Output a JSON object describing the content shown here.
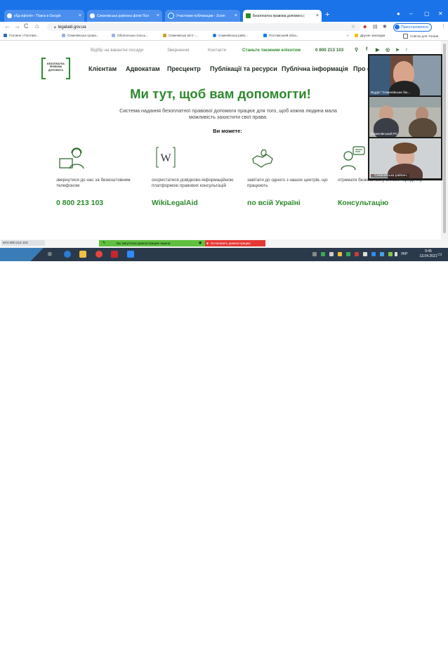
{
  "browser": {
    "tabs": [
      {
        "title": "убд ефіопія - Поиск в Google",
        "favicon_color": "#ffffff",
        "active": false
      },
      {
        "title": "Семенівська районна філія Пол",
        "favicon_color": "#ffffff",
        "active": false
      },
      {
        "title": "Участники публикации - Zoom",
        "favicon_color": "#2d8cff",
        "active": false
      },
      {
        "title": "Безоплатна правова допомога |",
        "favicon_color": "#2f8a2f",
        "active": true
      }
    ],
    "url": "legalaid.gov.ua",
    "profile_status": "Приостановлена",
    "bookmarks": [
      "Головне | Полтавс...",
      "Семенівська грома...",
      "Оболонська сільсь...",
      "Семенівські вісті -...",
      "Семенівська райо...",
      "Полтавський обла...",
      "Другие закладки",
      "Список для чтения"
    ]
  },
  "site": {
    "top_links": [
      "Відбір на вакантні посади",
      "Звернення",
      "Контакти"
    ],
    "cta": "Станьте таємним клієнтом",
    "phone_top": "0 800 213 103",
    "logo_lines": [
      "БЕЗОПЛАТНА",
      "ПРАВОВА",
      "ДОПОМОГА"
    ],
    "main_nav": [
      "Клієнтам",
      "Адвокатам",
      "Пресцентр",
      "Публікації та ресурси",
      "Публічна інформація",
      "Про с"
    ],
    "hero_title": "Ми тут, щоб вам допомогти!",
    "hero_subtitle": "Система надання безоплатної правової допомоги працює для того, щоб кожна людина мала можливість захистити свої права.",
    "you_can": "Ви можете:",
    "features": [
      {
        "icon": "headset-icon",
        "desc": "звернутися до нас за безкоштовним телефоном",
        "big": "0 800 213 103"
      },
      {
        "icon": "wikipedia-icon",
        "desc": "скористатися довідково-інформаційною платформою правових консультацій",
        "big": "WikiLegalAid"
      },
      {
        "icon": "map-pin-icon",
        "desc": "завітати до одного з наших центрів, що працюють",
        "big": "по всій Україні"
      },
      {
        "icon": "lawyer-icon",
        "desc": "отримати безкоштовну онлайн юридичну",
        "big": "Консультацію"
      }
    ]
  },
  "zoom": {
    "participants": [
      "Відділ \"Семенівське бю...",
      "Семенівський РС",
      "Семенівська районн..."
    ]
  },
  "status": {
    "hover_url": "tel:0 800 213 103",
    "share_notice": "Вы запустили демонстрацию экрана",
    "stop_share": "Остановить демонстрацию"
  },
  "taskbar": {
    "lang": "УКР",
    "time": "9:45",
    "date": "13.04.2021"
  }
}
